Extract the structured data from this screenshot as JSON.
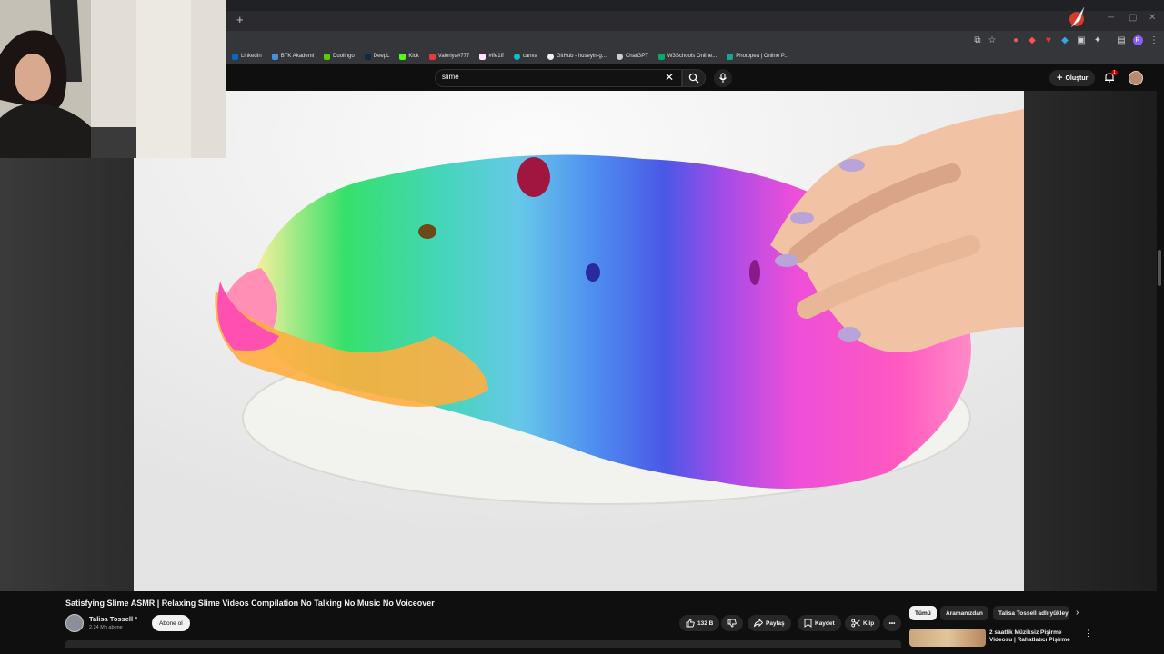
{
  "browser": {
    "new_tab_label": "+",
    "window_controls": [
      "─",
      "▢",
      "✕"
    ],
    "bookmarks": [
      {
        "label": "LinkedIn",
        "color": "#0a66c2"
      },
      {
        "label": "BTK Akademi",
        "color": "#4a90d9"
      },
      {
        "label": "Duolingo",
        "color": "#58cc02"
      },
      {
        "label": "DeepL",
        "color": "#0f2b46"
      },
      {
        "label": "Kick",
        "color": "#53fc18"
      },
      {
        "label": "Valeriya#777",
        "color": "#e23b3b"
      },
      {
        "label": "#ffe1ff",
        "color": "#ffe1ff"
      },
      {
        "label": "canva",
        "color": "#00c4cc"
      },
      {
        "label": "GitHub - huseyin-g...",
        "color": "#f0f0f0"
      },
      {
        "label": "ChatGPT",
        "color": "#cfcfcf"
      },
      {
        "label": "W3Schools Online...",
        "color": "#04aa6d"
      },
      {
        "label": "Photopea | Online P...",
        "color": "#18a497"
      }
    ]
  },
  "header": {
    "search_query": "slime",
    "create_label": "Oluştur",
    "notification_count": "1"
  },
  "video": {
    "title": "Satisfying Slime ASMR | Relaxing Slime Videos Compilation No Talking No Music No Voiceover",
    "channel_name": "Talisa Tossell",
    "subscribers": "2,24 Mn abone",
    "subscribe_label": "Abone ol",
    "like_count": "132 B",
    "share_label": "Paylaş",
    "save_label": "Kaydet",
    "clip_label": "Klip",
    "more_label": "•••"
  },
  "sidebar": {
    "chips": [
      "Tümü",
      "Aramanızdan",
      "Talisa Tossell adlı yükleyiciden"
    ],
    "recommendation_title": "2 saatlik Müziksiz Pişirme Videosu | Rahatlatıcı Pişirme"
  },
  "colors": {
    "background": "#0f0f0f",
    "chip_active": "#f1f1f1",
    "button_bg": "#272727",
    "accent_red": "#cc0000"
  }
}
